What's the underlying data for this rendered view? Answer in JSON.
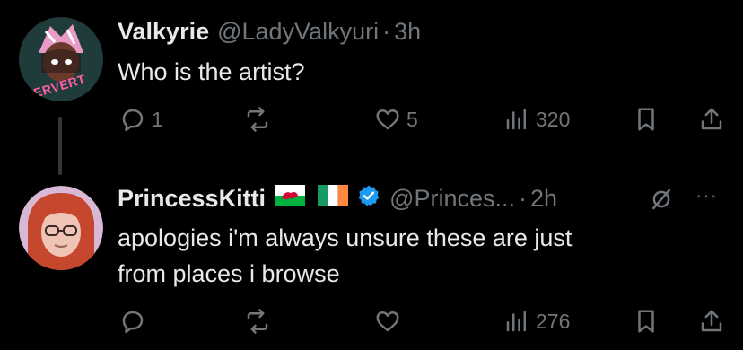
{
  "post1": {
    "display_name": "Valkyrie",
    "handle": "@LadyValkyuri",
    "separator": "·",
    "time": "3h",
    "text": "Who is the artist?",
    "avatar_badge": "PERVERT",
    "actions": {
      "replies": "1",
      "reposts": "",
      "likes": "5",
      "views": "320"
    }
  },
  "post2": {
    "display_name": "PrincessKitti",
    "handle": "@Princes...",
    "separator": "·",
    "time": "2h",
    "text_line1": "apologies i'm always unsure these are just",
    "text_line2": "from places i browse",
    "badges": [
      "wales-flag",
      "ireland-flag",
      "verified-badge"
    ],
    "actions": {
      "replies": "",
      "reposts": "",
      "likes": "",
      "views": "276"
    },
    "more": "···"
  },
  "colors": {
    "background": "#000000",
    "text": "#e7e9ea",
    "muted": "#71767b",
    "verified": "#1d9bf0"
  }
}
